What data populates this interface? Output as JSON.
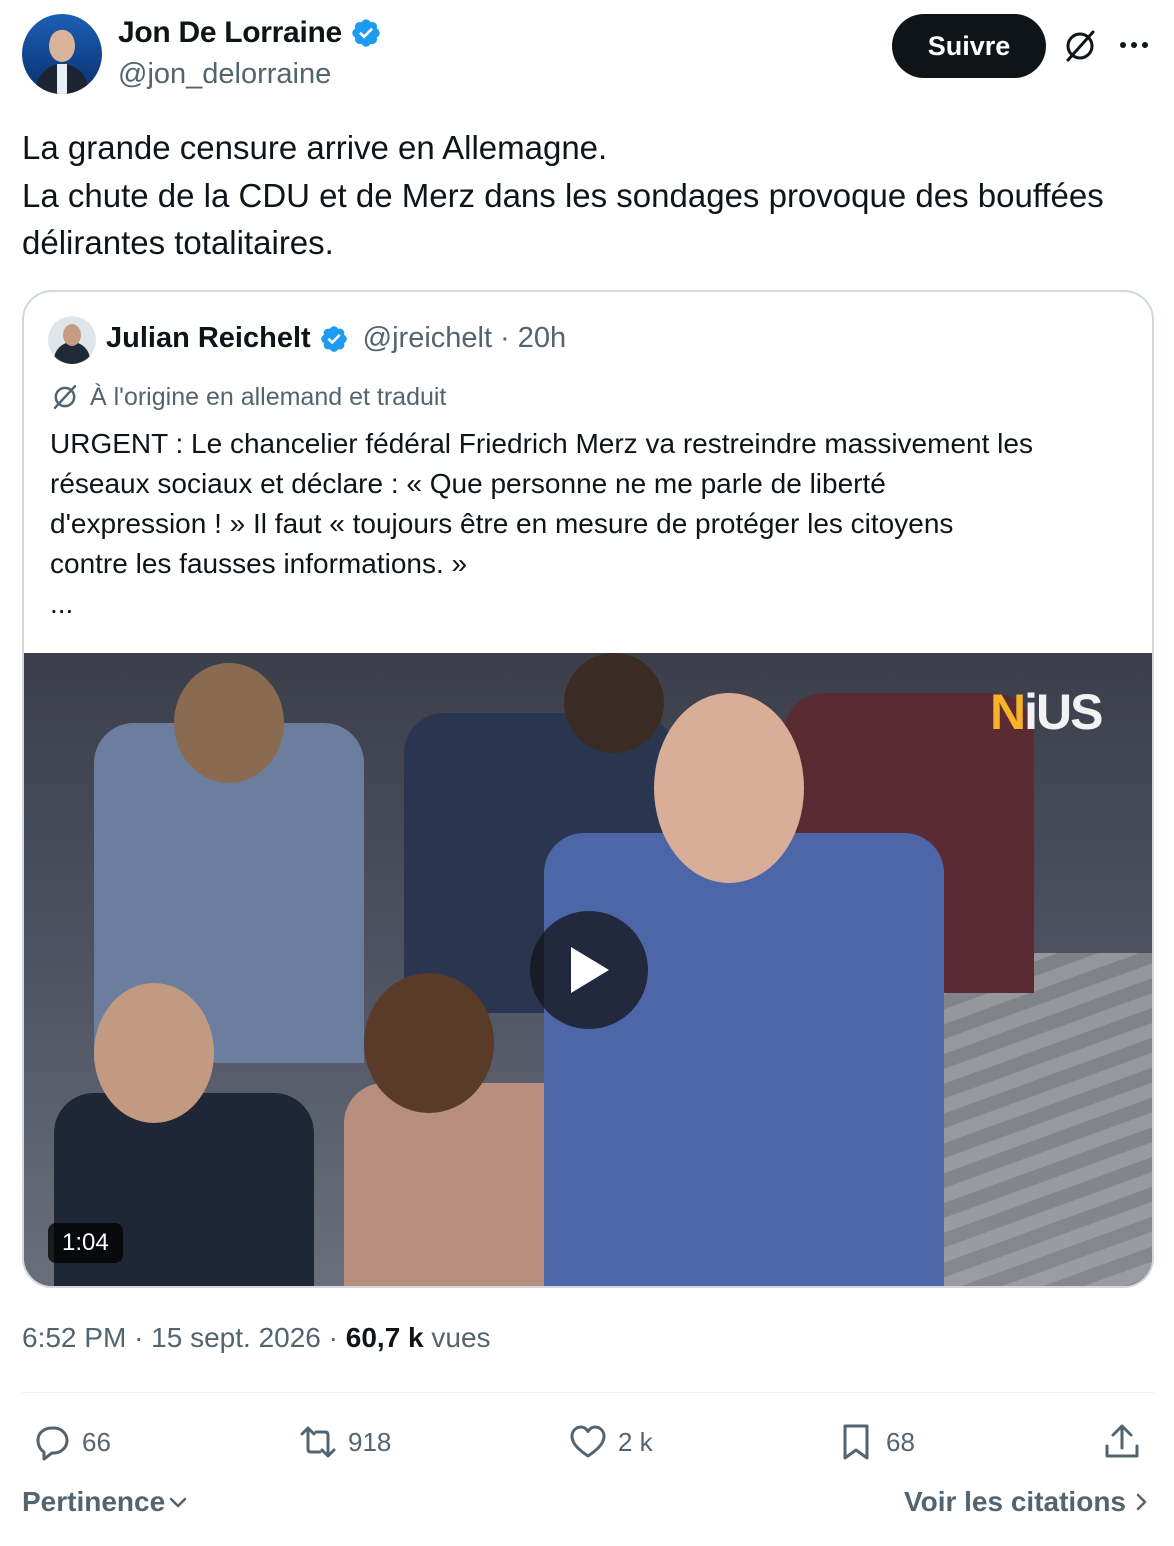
{
  "author": {
    "display_name": "Jon De Lorraine",
    "handle": "@jon_delorraine",
    "verified": true
  },
  "header": {
    "follow_label": "Suivre"
  },
  "tweet": {
    "lines": [
      "La grande censure arrive en Allemagne.",
      "La chute de la CDU et de Merz dans les sondages provoque des bouffées",
      "délirantes totalitaires."
    ]
  },
  "quote": {
    "display_name": "Julian Reichelt",
    "handle": "@jreichelt",
    "separator": "·",
    "time": "20h",
    "translated_note": "À l'origine en allemand et traduit",
    "lines": [
      "URGENT : Le chancelier fédéral Friedrich Merz va restreindre massivement les",
      "réseaux sociaux et déclare : « Que personne ne me parle de liberté",
      "d'expression ! » Il faut « toujours être en mesure de protéger les citoyens",
      "contre les fausses informations. »",
      "..."
    ],
    "video": {
      "watermark_n": "N",
      "watermark_rest": "iUS",
      "duration": "1:04"
    }
  },
  "meta": {
    "time": "6:52 PM",
    "separator": "·",
    "date": "15 sept. 2026",
    "views_count": "60,7 k",
    "views_label": "vues"
  },
  "actions": {
    "replies": "66",
    "reposts": "918",
    "likes": "2 k",
    "bookmarks": "68"
  },
  "footer": {
    "sort_label": "Pertinence",
    "quotes_label": "Voir les citations"
  },
  "colors": {
    "verified_blue": "#1d9bf0",
    "text_primary": "#0f1419",
    "text_secondary": "#536471",
    "border": "#cfd9de"
  }
}
